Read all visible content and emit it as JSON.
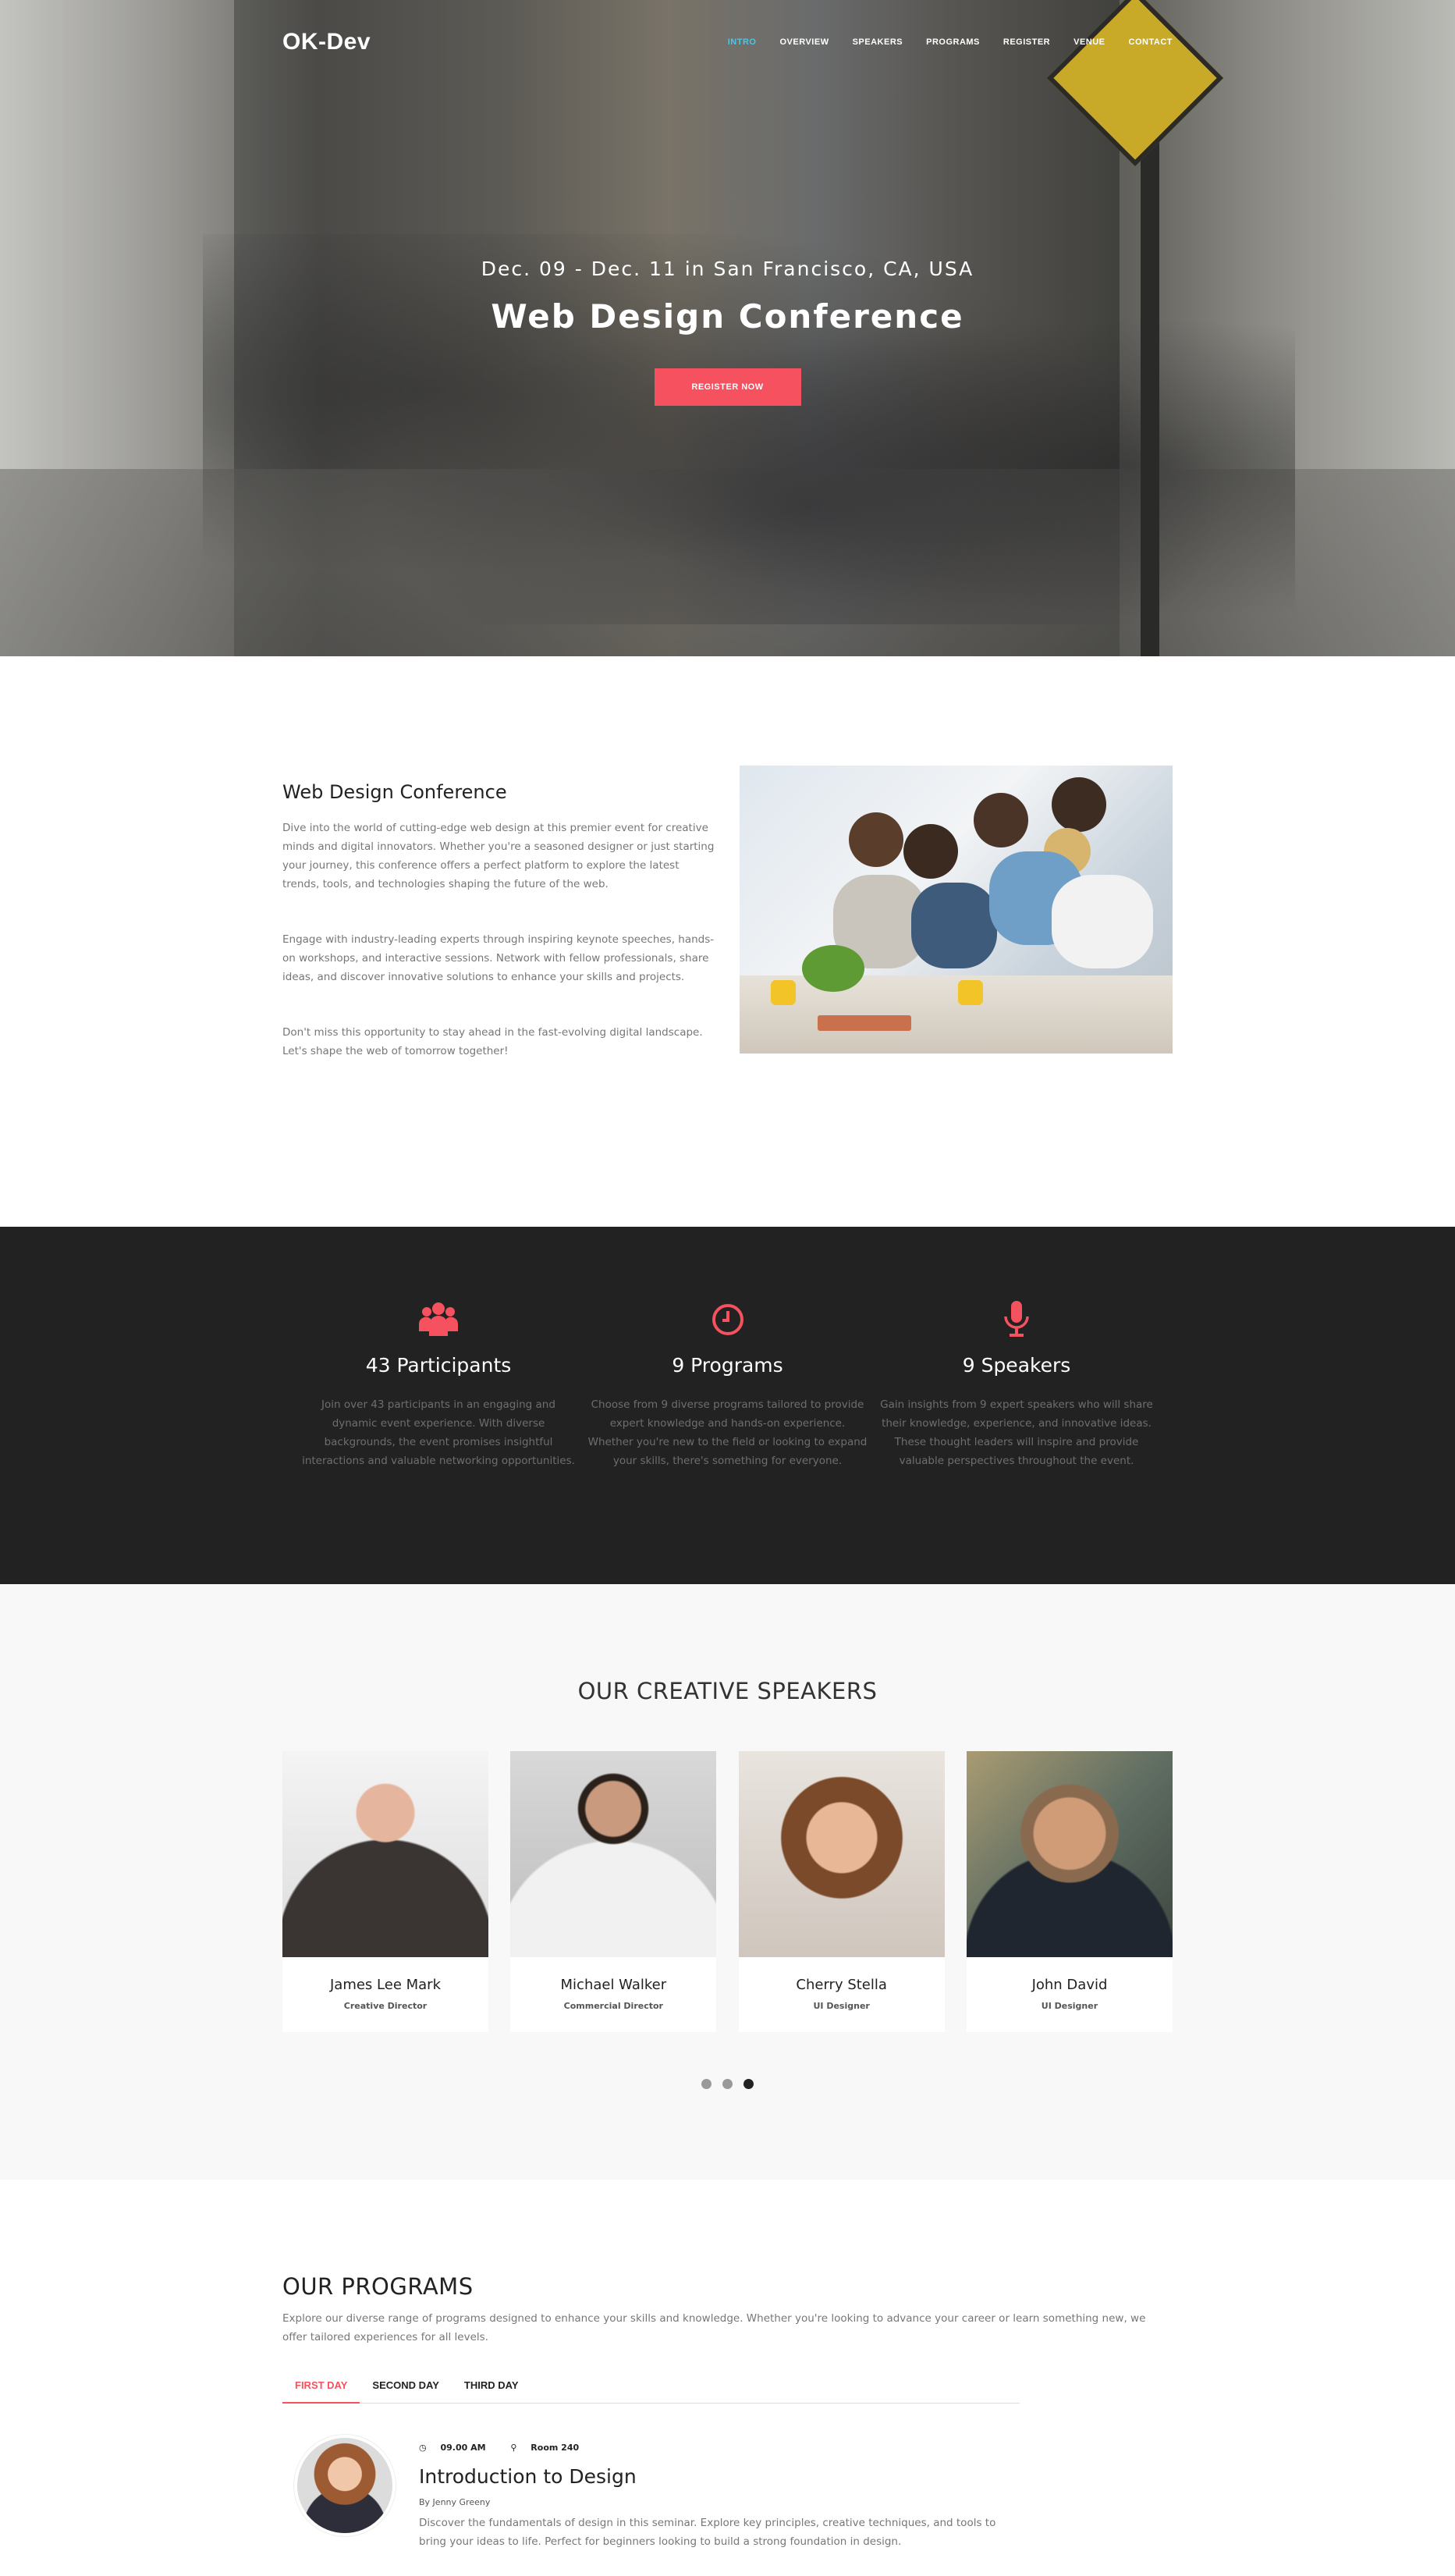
{
  "nav": {
    "logo": "OK-Dev",
    "items": [
      "INTRO",
      "OVERVIEW",
      "SPEAKERS",
      "PROGRAMS",
      "REGISTER",
      "VENUE",
      "CONTACT"
    ],
    "active": "INTRO",
    "active_color": "#4cc5e8"
  },
  "hero": {
    "date_line": "Dec. 09 - Dec. 11 in San Francisco, CA, USA",
    "title": "Web Design Conference",
    "cta": "REGISTER NOW"
  },
  "about": {
    "title": "Web Design Conference",
    "paragraphs": [
      "Dive into the world of cutting-edge web design at this premier event for creative minds and digital innovators. Whether you're a seasoned designer or just starting your journey, this conference offers a perfect platform to explore the latest trends, tools, and technologies shaping the future of the web.",
      "Engage with industry-leading experts through inspiring keynote speeches, hands-on workshops, and interactive sessions. Network with fellow professionals, share ideas, and discover innovative solutions to enhance your skills and projects.",
      "Don't miss this opportunity to stay ahead in the fast-evolving digital landscape. Let's shape the web of tomorrow together!"
    ]
  },
  "stats": [
    {
      "icon": "users-icon",
      "title": "43 Participants",
      "text": "Join over 43 participants in an engaging and dynamic event experience. With diverse backgrounds, the event promises insightful interactions and valuable networking opportunities."
    },
    {
      "icon": "clock-icon",
      "title": "9 Programs",
      "text": "Choose from 9 diverse programs tailored to provide expert knowledge and hands-on experience. Whether you're new to the field or looking to expand your skills, there's something for everyone."
    },
    {
      "icon": "microphone-icon",
      "title": "9 Speakers",
      "text": "Gain insights from 9 expert speakers who will share their knowledge, experience, and innovative ideas. These thought leaders will inspire and provide valuable perspectives throughout the event."
    }
  ],
  "speakers": {
    "title": "OUR CREATIVE SPEAKERS",
    "items": [
      {
        "name": "James Lee Mark",
        "role": "Creative Director"
      },
      {
        "name": "Michael Walker",
        "role": "Commercial Director"
      },
      {
        "name": "Cherry Stella",
        "role": "UI Designer"
      },
      {
        "name": "John David",
        "role": "UI Designer"
      }
    ],
    "page_count": 3,
    "active_page": 3
  },
  "programs": {
    "title": "OUR PROGRAMS",
    "description": "Explore our diverse range of programs designed to enhance your skills and knowledge. Whether you're looking to advance your career or learn something new, we offer tailored experiences for all levels.",
    "tabs": [
      "FIRST DAY",
      "SECOND DAY",
      "THIRD DAY"
    ],
    "active_tab": "FIRST DAY",
    "session": {
      "time": "09.00 AM",
      "room": "Room 240",
      "title": "Introduction to Design",
      "by": "By Jenny Greeny",
      "description": "Discover the fundamentals of design in this seminar. Explore key principles, creative techniques, and tools to bring your ideas to life. Perfect for beginners looking to build a strong foundation in design."
    }
  },
  "colors": {
    "accent": "#f5515f",
    "dark_section": "#222222",
    "light_section": "#f8f8f8"
  }
}
